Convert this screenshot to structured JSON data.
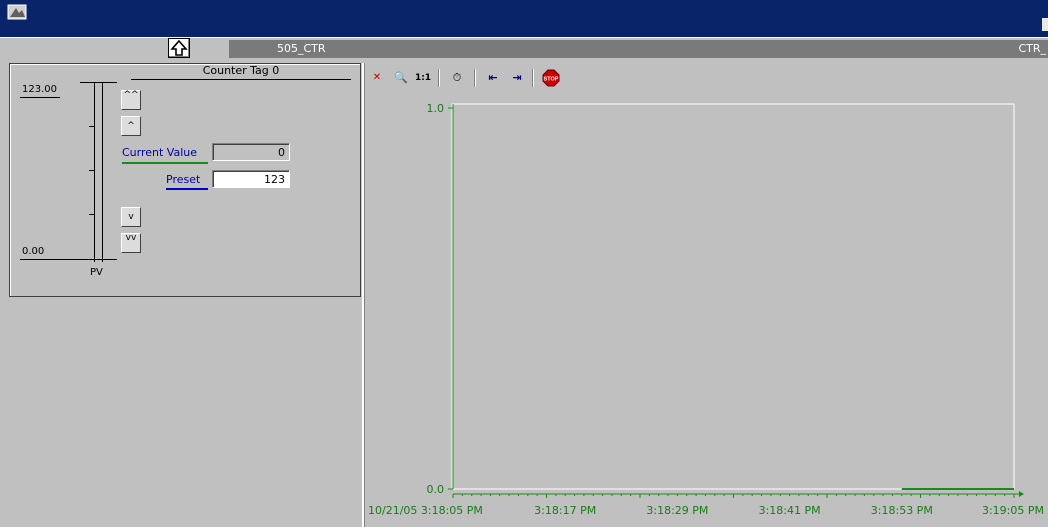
{
  "window": {
    "title": ""
  },
  "nav": {
    "up_button": "↑",
    "tag_name": "505_CTR",
    "tag_short": "CTR_"
  },
  "counter": {
    "title": "Counter Tag 0",
    "scale_max": "123.00",
    "scale_min": "0.00",
    "pv_label": "PV",
    "current_value_label": "Current Value",
    "current_value": "0",
    "preset_label": "Preset",
    "preset_value": "123",
    "fast_up": "^^",
    "up": "^",
    "down": "v",
    "fast_down": "vv"
  },
  "trend": {
    "toolbar": {
      "zoom": "🔍",
      "one_to_one": "1:1",
      "clock": "⏱",
      "scroll_left": "⇤",
      "scroll_right": "⇥",
      "stop": "STOP"
    },
    "y_top_label": "1.0",
    "y_bottom_label": "0.0",
    "x_labels": [
      "10/21/05  3:18:05 PM",
      "3:18:17 PM",
      "3:18:29 PM",
      "3:18:41 PM",
      "3:18:53 PM",
      "3:19:05 PM"
    ],
    "line_color": "#1a8a1a"
  },
  "chart_data": {
    "type": "line",
    "title": "",
    "xlabel": "",
    "ylabel": "",
    "ylim": [
      0.0,
      1.0
    ],
    "x": [
      "10/21/05 3:18:05 PM",
      "3:18:17 PM",
      "3:18:29 PM",
      "3:18:41 PM",
      "3:18:53 PM",
      "3:19:05 PM"
    ],
    "series": [
      {
        "values": [
          null,
          null,
          null,
          null,
          0.0,
          0.0
        ]
      }
    ],
    "grid": false
  }
}
